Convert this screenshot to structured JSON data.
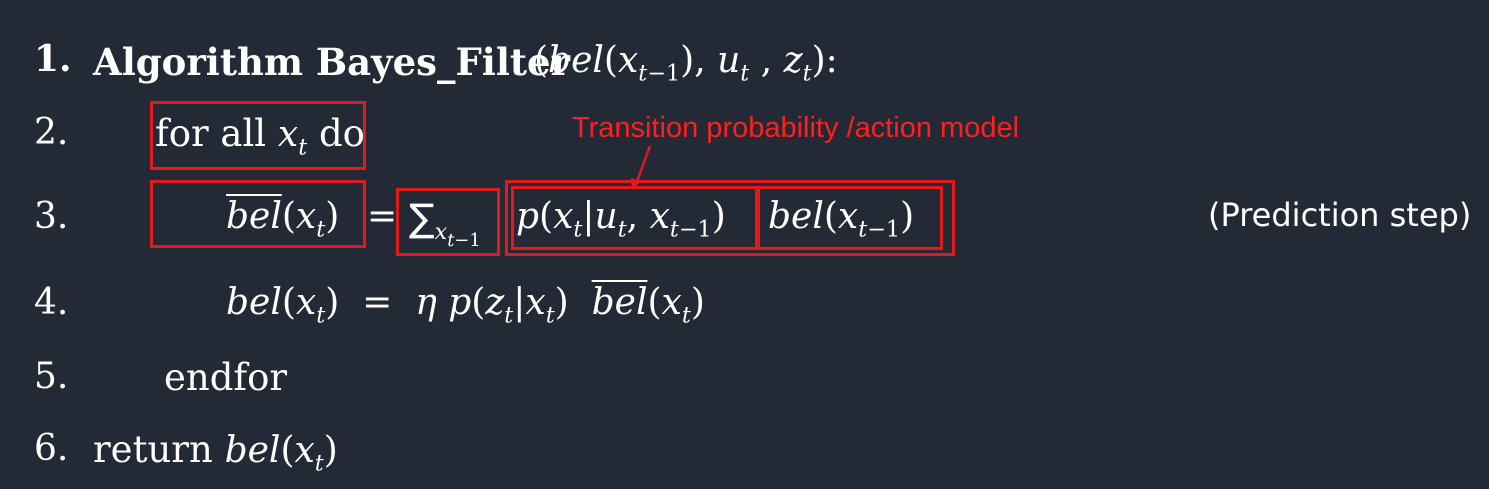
{
  "lines": [
    {
      "number": "1.",
      "keyword": "Algorithm Bayes_Filter",
      "args": "(bel(x_{t−1}), u_t , z_t):"
    },
    {
      "number": "2.",
      "text": "for all x_t do"
    },
    {
      "number": "3.",
      "text": "bel-bar(x_t) = Σ_{x_{t−1}} p(x_t|u_t, x_{t−1}) bel(x_{t−1})"
    },
    {
      "number": "4.",
      "text": "bel(x_t) = η p(z_t|x_t) bel-bar(x_t)"
    },
    {
      "number": "5.",
      "text": "endfor"
    },
    {
      "number": "6.",
      "text": "return bel(x_t)"
    }
  ],
  "annotation": "Transition probability /action model",
  "prediction_label": "(Prediction step)",
  "colors": {
    "background": "#232a35",
    "text": "#ffffff",
    "highlight": "#e41a1a"
  }
}
